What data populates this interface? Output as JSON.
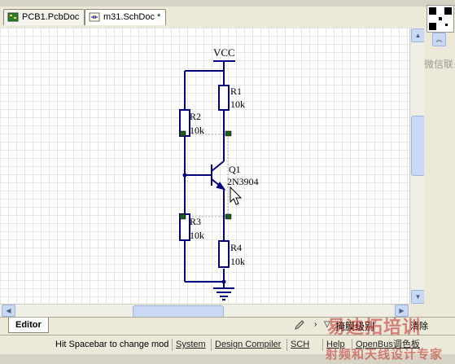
{
  "doc_tabs": [
    {
      "label": "PCB1.PcbDoc",
      "icon": "pcb-doc-icon",
      "active": false
    },
    {
      "label": "m31.SchDoc *",
      "icon": "sch-doc-icon",
      "active": true
    }
  ],
  "schematic": {
    "power_label": "VCC",
    "components": [
      {
        "designator": "R1",
        "value": "10k"
      },
      {
        "designator": "R2",
        "value": "10k"
      },
      {
        "designator": "Q1",
        "value": "2N3904"
      },
      {
        "designator": "R3",
        "value": "10k"
      },
      {
        "designator": "R4",
        "value": "10k"
      }
    ]
  },
  "editor": {
    "tab_label": "Editor",
    "mask_level_label": "掩膜级别",
    "clear_label": "清除"
  },
  "statusbar": {
    "message": "Hit Spacebar to change mod",
    "panels": [
      "System",
      "Design Compiler",
      "SCH",
      "Help",
      "OpenBus调色板"
    ]
  },
  "watermark": {
    "top_right": "微信联系",
    "bottom_right": "易迪拓培训",
    "bottom_sub": "射频和天线设计专家"
  },
  "colors": {
    "wire": "#000080",
    "component": "#000080",
    "resistor_fill": "#ffffff",
    "pin": "#000000",
    "accent": "#c8d8f5"
  }
}
